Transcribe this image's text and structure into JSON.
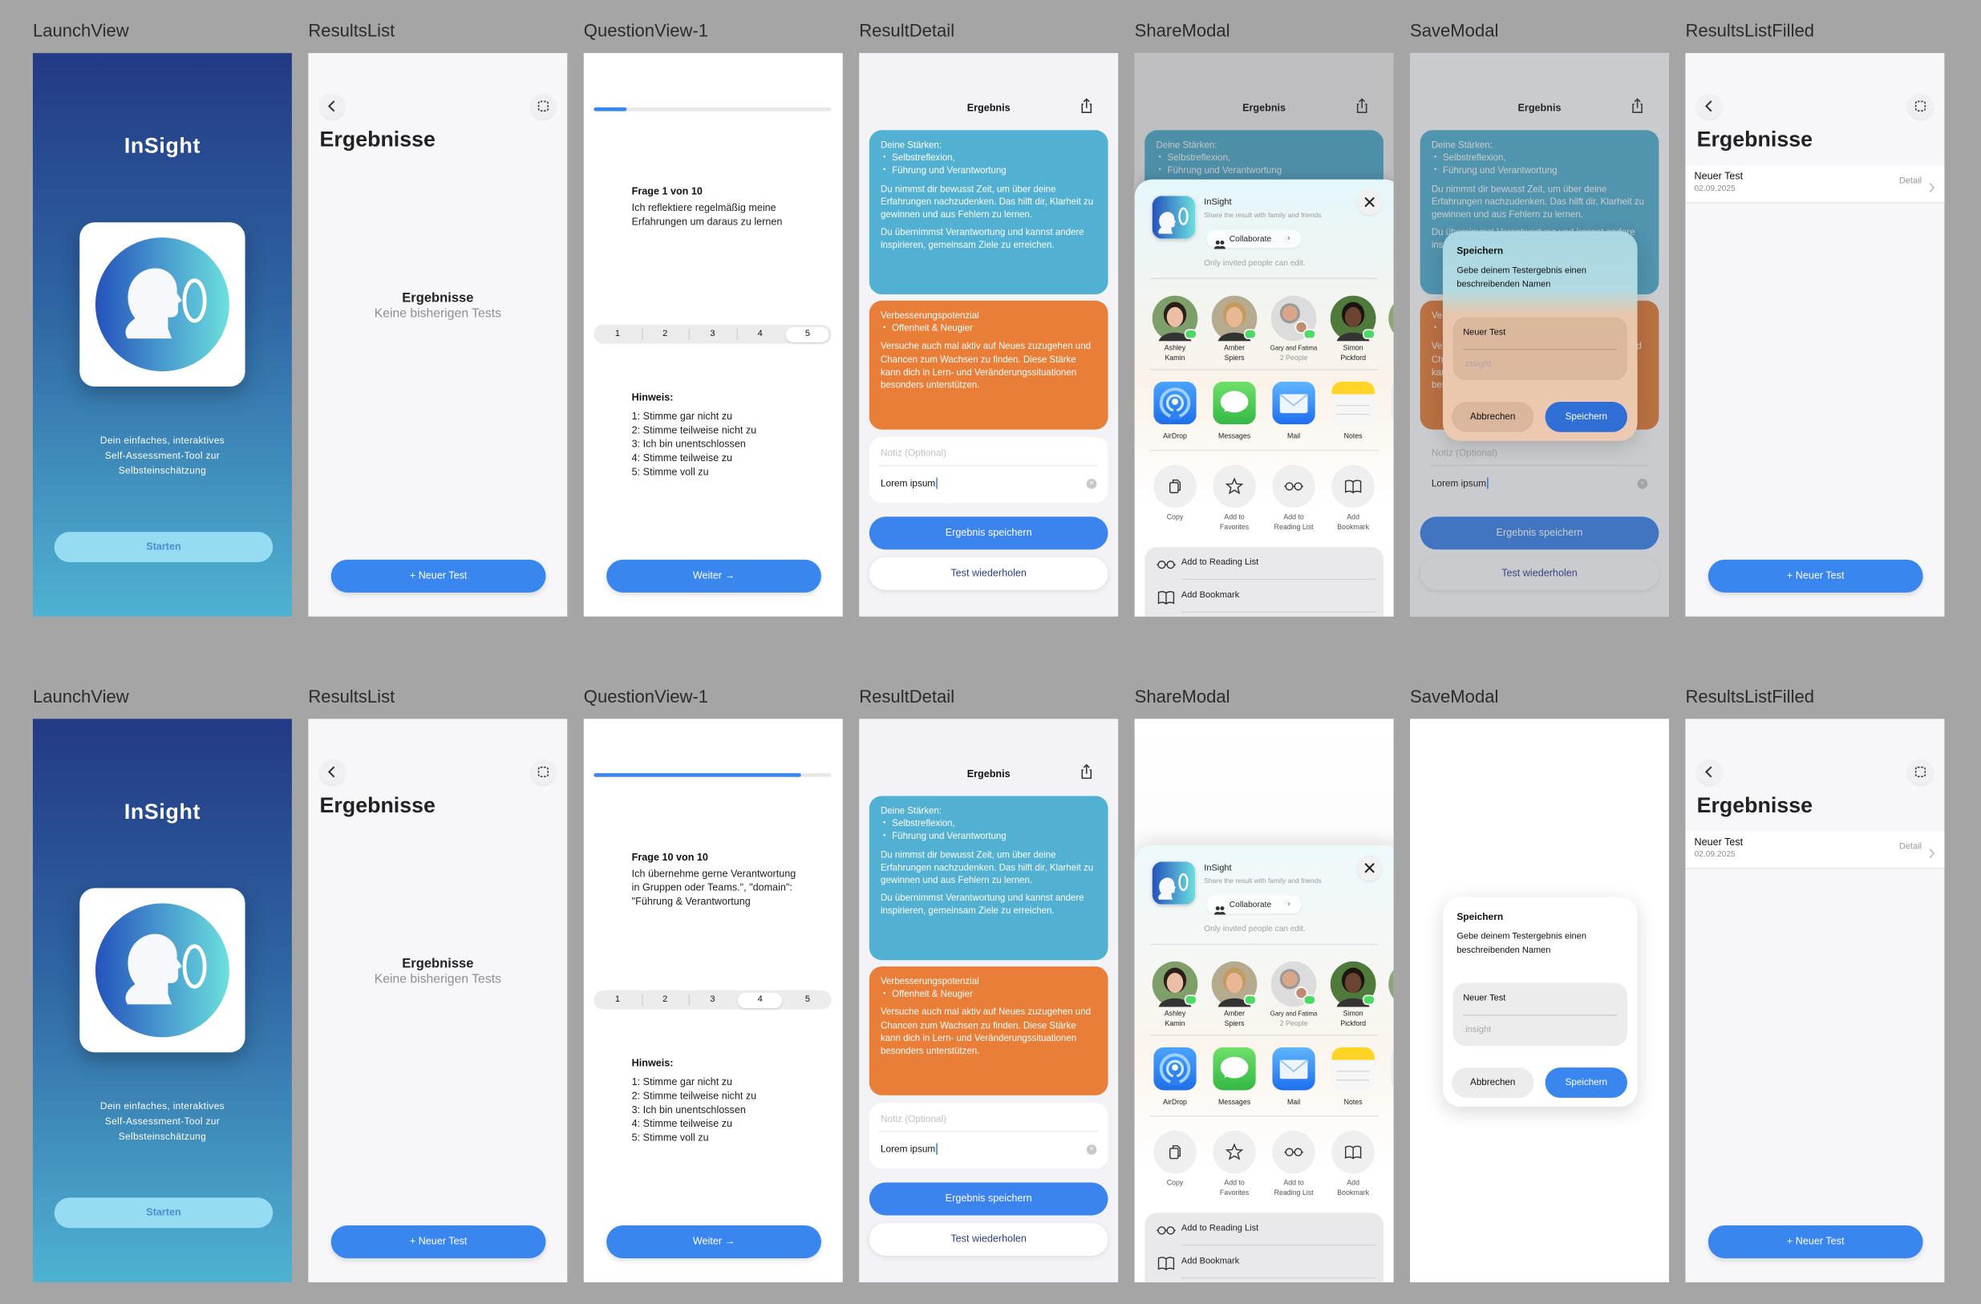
{
  "rows": [
    {
      "screens": [
        {
          "label": "LaunchView",
          "type": "launch"
        },
        {
          "label": "ResultsList",
          "type": "results_list"
        },
        {
          "label": "QuestionView-1",
          "type": "question",
          "variant": 0
        },
        {
          "label": "ResultDetail",
          "type": "result_detail"
        },
        {
          "label": "ShareModal",
          "type": "share",
          "variant": 0
        },
        {
          "label": "SaveModal",
          "type": "save",
          "variant": 0
        },
        {
          "label": "ResultsListFilled",
          "type": "results_filled"
        }
      ]
    },
    {
      "screens": [
        {
          "label": "LaunchView",
          "type": "launch"
        },
        {
          "label": "ResultsList",
          "type": "results_list"
        },
        {
          "label": "QuestionView-1",
          "type": "question",
          "variant": 1
        },
        {
          "label": "ResultDetail",
          "type": "result_detail"
        },
        {
          "label": "ShareModal",
          "type": "share",
          "variant": 1
        },
        {
          "label": "SaveModal",
          "type": "save",
          "variant": 1
        },
        {
          "label": "ResultsListFilled",
          "type": "results_filled"
        }
      ]
    }
  ],
  "launch": {
    "title": "InSight",
    "description_lines": [
      "Dein einfaches, interaktives",
      "Self-Assessment-Tool zur",
      "Selbsteinschätzung"
    ],
    "start_label": "Starten"
  },
  "results_list": {
    "title": "Ergebnisse",
    "empty_title": "Ergebnisse",
    "empty_subtitle": "Keine bisherigen Tests",
    "new_test_label": "+ Neuer Test"
  },
  "results_filled": {
    "title": "Ergebnisse",
    "items": [
      {
        "name": "Neuer Test",
        "date": "02.09.2025",
        "action": "Detail"
      }
    ],
    "new_test_label": "+ Neuer Test"
  },
  "question_common": {
    "scale_options": [
      "1",
      "2",
      "3",
      "4",
      "5"
    ],
    "hint_title": "Hinweis:",
    "hints": [
      "1: Stimme gar nicht zu",
      "2: Stimme teilweise nicht zu",
      "3: Ich bin unentschlossen",
      "4: Stimme teilweise zu",
      "5: Stimme voll zu"
    ],
    "next_label": "Weiter →"
  },
  "questions": [
    {
      "counter": "Frage 1 von 10",
      "text": "Ich reflektiere regelmäßig meine Erfahrungen um daraus zu lernen",
      "progress": 0.14,
      "selected": 5
    },
    {
      "counter": "Frage 10 von 10",
      "text": "Ich übernehme gerne Verantwortung in Gruppen oder Teams.\", \"domain\": \"Führung & Verantwortung",
      "progress": 0.87,
      "selected": 4
    }
  ],
  "result_detail": {
    "title": "Ergebnis",
    "strengths": {
      "heading": "Deine Stärken:",
      "items": [
        "Selbstreflexion,",
        "Führung und Verantwortung"
      ],
      "paragraphs": [
        "Du nimmst dir bewusst Zeit, um über deine Erfahrungen nachzudenken. Das hilft dir, Klarheit zu gewinnen und aus Fehlern zu lernen.",
        "Du übernimmst Verantwortung und kannst andere inspirieren, gemeinsam Ziele zu erreichen."
      ]
    },
    "improvement": {
      "heading": "Verbesserungspotenzial",
      "items": [
        "Offenheit & Neugier"
      ],
      "paragraphs": [
        "Versuche auch mal aktiv auf Neues zuzugehen und Chancen zum Wachsen zu finden. Diese Stärke kann dich in Lern- und Veränderungssituationen besonders unterstützen."
      ]
    },
    "note_placeholder": "Notiz (Optional)",
    "note_value": "Lorem ipsum",
    "save_label": "Ergebnis speichern",
    "repeat_label": "Test wiederholen"
  },
  "share_sheet": {
    "app_name": "InSight",
    "subtitle": "Share the result with family and friends",
    "collaborate_label": "Collaborate",
    "permission": "Only invited people can edit.",
    "people": [
      {
        "lines": [
          "Ashley",
          "Kamin"
        ]
      },
      {
        "lines": [
          "Amber",
          "Spiers"
        ]
      },
      {
        "lines": [
          "Gary and Fatima"
        ],
        "sub": "2 People"
      },
      {
        "lines": [
          "Simon",
          "Pickford"
        ]
      }
    ],
    "apps": [
      "AirDrop",
      "Messages",
      "Mail",
      "Notes"
    ],
    "actions": [
      {
        "lines": [
          "Copy"
        ],
        "icon": "copy-icon"
      },
      {
        "lines": [
          "Add to",
          "Favorites"
        ],
        "icon": "star-icon"
      },
      {
        "lines": [
          "Add to",
          "Reading List"
        ],
        "icon": "glasses-icon"
      },
      {
        "lines": [
          "Add",
          "Bookmark"
        ],
        "icon": "book-icon"
      }
    ],
    "list_actions": [
      "Add to Reading List",
      "Add Bookmark"
    ]
  },
  "save_modal": {
    "title": "Speichern",
    "message": "Gebe deinem Testergebnis einen beschreibenden Namen",
    "name_value": "Neuer Test",
    "extension_placeholder": ".insight",
    "cancel_label": "Abbrechen",
    "confirm_label": "Speichern"
  },
  "colors": {
    "accent": "#3a86ef",
    "strengths_card": "#52b1d2",
    "improvement_card": "#e97e38",
    "launch_top": "#233a84",
    "launch_bottom": "#4fb2d2"
  }
}
